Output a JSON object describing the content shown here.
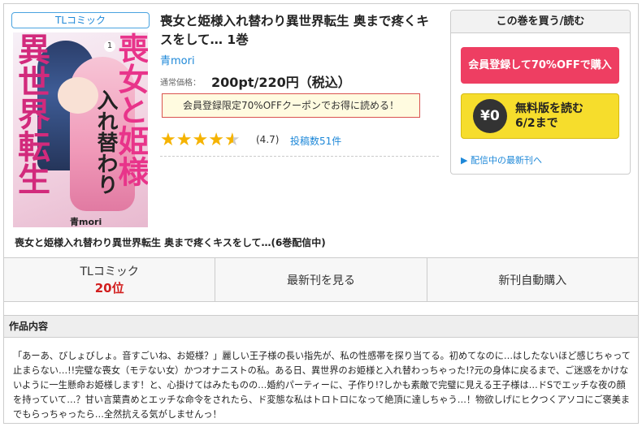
{
  "category_badge": "TLコミック",
  "cover": {
    "volume_number": "1",
    "title_part1": "異世界転生",
    "title_part2": "喪女と姫様",
    "title_part3": "入れ替わり",
    "author": "青mori"
  },
  "book": {
    "title": "喪女と姫様入れ替わり異世界転生 奥まで疼くキスをして… 1巻",
    "author": "青mori",
    "price_label": "通常価格：",
    "price": "200pt/220円（税込）",
    "coupon_text": "会員登録限定70%OFFクーポンでお得に読める！",
    "rating_value": 4.7,
    "rating_text": "(4.7)",
    "reviews_text": "投稿数51件"
  },
  "panel": {
    "header": "この巻を買う/読む",
    "member_button": "会員登録して70%OFFで購入",
    "free_badge": "¥0",
    "free_line1": "無料版を読む",
    "free_line2": "6/2まで",
    "latest_link": "▶ 配信中の最新刊へ"
  },
  "series_title": "喪女と姫様入れ替わり異世界転生 奥まで疼くキスをして…(6巻配信中)",
  "tabs": {
    "genre": "TLコミック",
    "rank": "20位",
    "latest": "最新刊を見る",
    "auto": "新刊自動購入"
  },
  "description": {
    "heading": "作品内容",
    "body": "「あーあ、びしょびしょ。音すごいね、お姫様？」麗しい王子様の長い指先が、私の性感帯を探り当てる。初めてなのに…はしたないほど感じちゃって止まらない…!!完璧な喪女（モテない女）かつオナニストの私。ある日、異世界のお姫様と入れ替わっちゃった!?元の身体に戻るまで、ご迷惑をかけないように一生懸命お姫様します！と、心掛けてはみたものの…婚約パーティーに、子作り!?しかも素敵で完璧に見える王子様は…ドSでエッチな夜の顔を持っていて…？甘い言葉責めとエッチな命令をされたら、ド変態な私はトロトロになって絶頂に達しちゃう…！物欲しげにヒクつくアソコにご褒美までもらっちゃったら…全然抗える気がしませんっ！"
  }
}
